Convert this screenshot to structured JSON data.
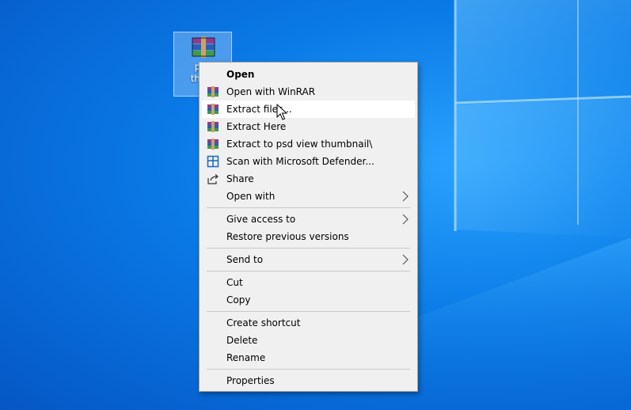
{
  "desktop": {
    "icon": {
      "name": "winrar-archive-icon",
      "label_lines": [
        "psd",
        "thum"
      ]
    }
  },
  "context_menu": {
    "items": [
      {
        "label": "Open",
        "bold": true,
        "icon": ""
      },
      {
        "label": "Open with WinRAR",
        "icon": "winrar-icon"
      },
      {
        "label": "Extract files...",
        "icon": "winrar-icon",
        "highlighted": true
      },
      {
        "label": "Extract Here",
        "icon": "winrar-icon"
      },
      {
        "label": "Extract to psd view thumbnail\\",
        "icon": "winrar-icon"
      },
      {
        "label": "Scan with Microsoft Defender...",
        "icon": "defender-icon"
      },
      {
        "label": "Share",
        "icon": "share-icon"
      },
      {
        "label": "Open with",
        "icon": "",
        "submenu": true
      },
      {
        "label": "Give access to",
        "icon": "",
        "submenu": true
      },
      {
        "label": "Restore previous versions",
        "icon": ""
      },
      {
        "label": "Send to",
        "icon": "",
        "submenu": true
      },
      {
        "label": "Cut",
        "icon": ""
      },
      {
        "label": "Copy",
        "icon": ""
      },
      {
        "label": "Create shortcut",
        "icon": ""
      },
      {
        "label": "Delete",
        "icon": ""
      },
      {
        "label": "Rename",
        "icon": ""
      },
      {
        "label": "Properties",
        "icon": ""
      }
    ]
  },
  "colors": {
    "menu_background": "#f0f0f0",
    "highlight": "#ffffff",
    "desktop_blue": "#0a7ae6"
  }
}
